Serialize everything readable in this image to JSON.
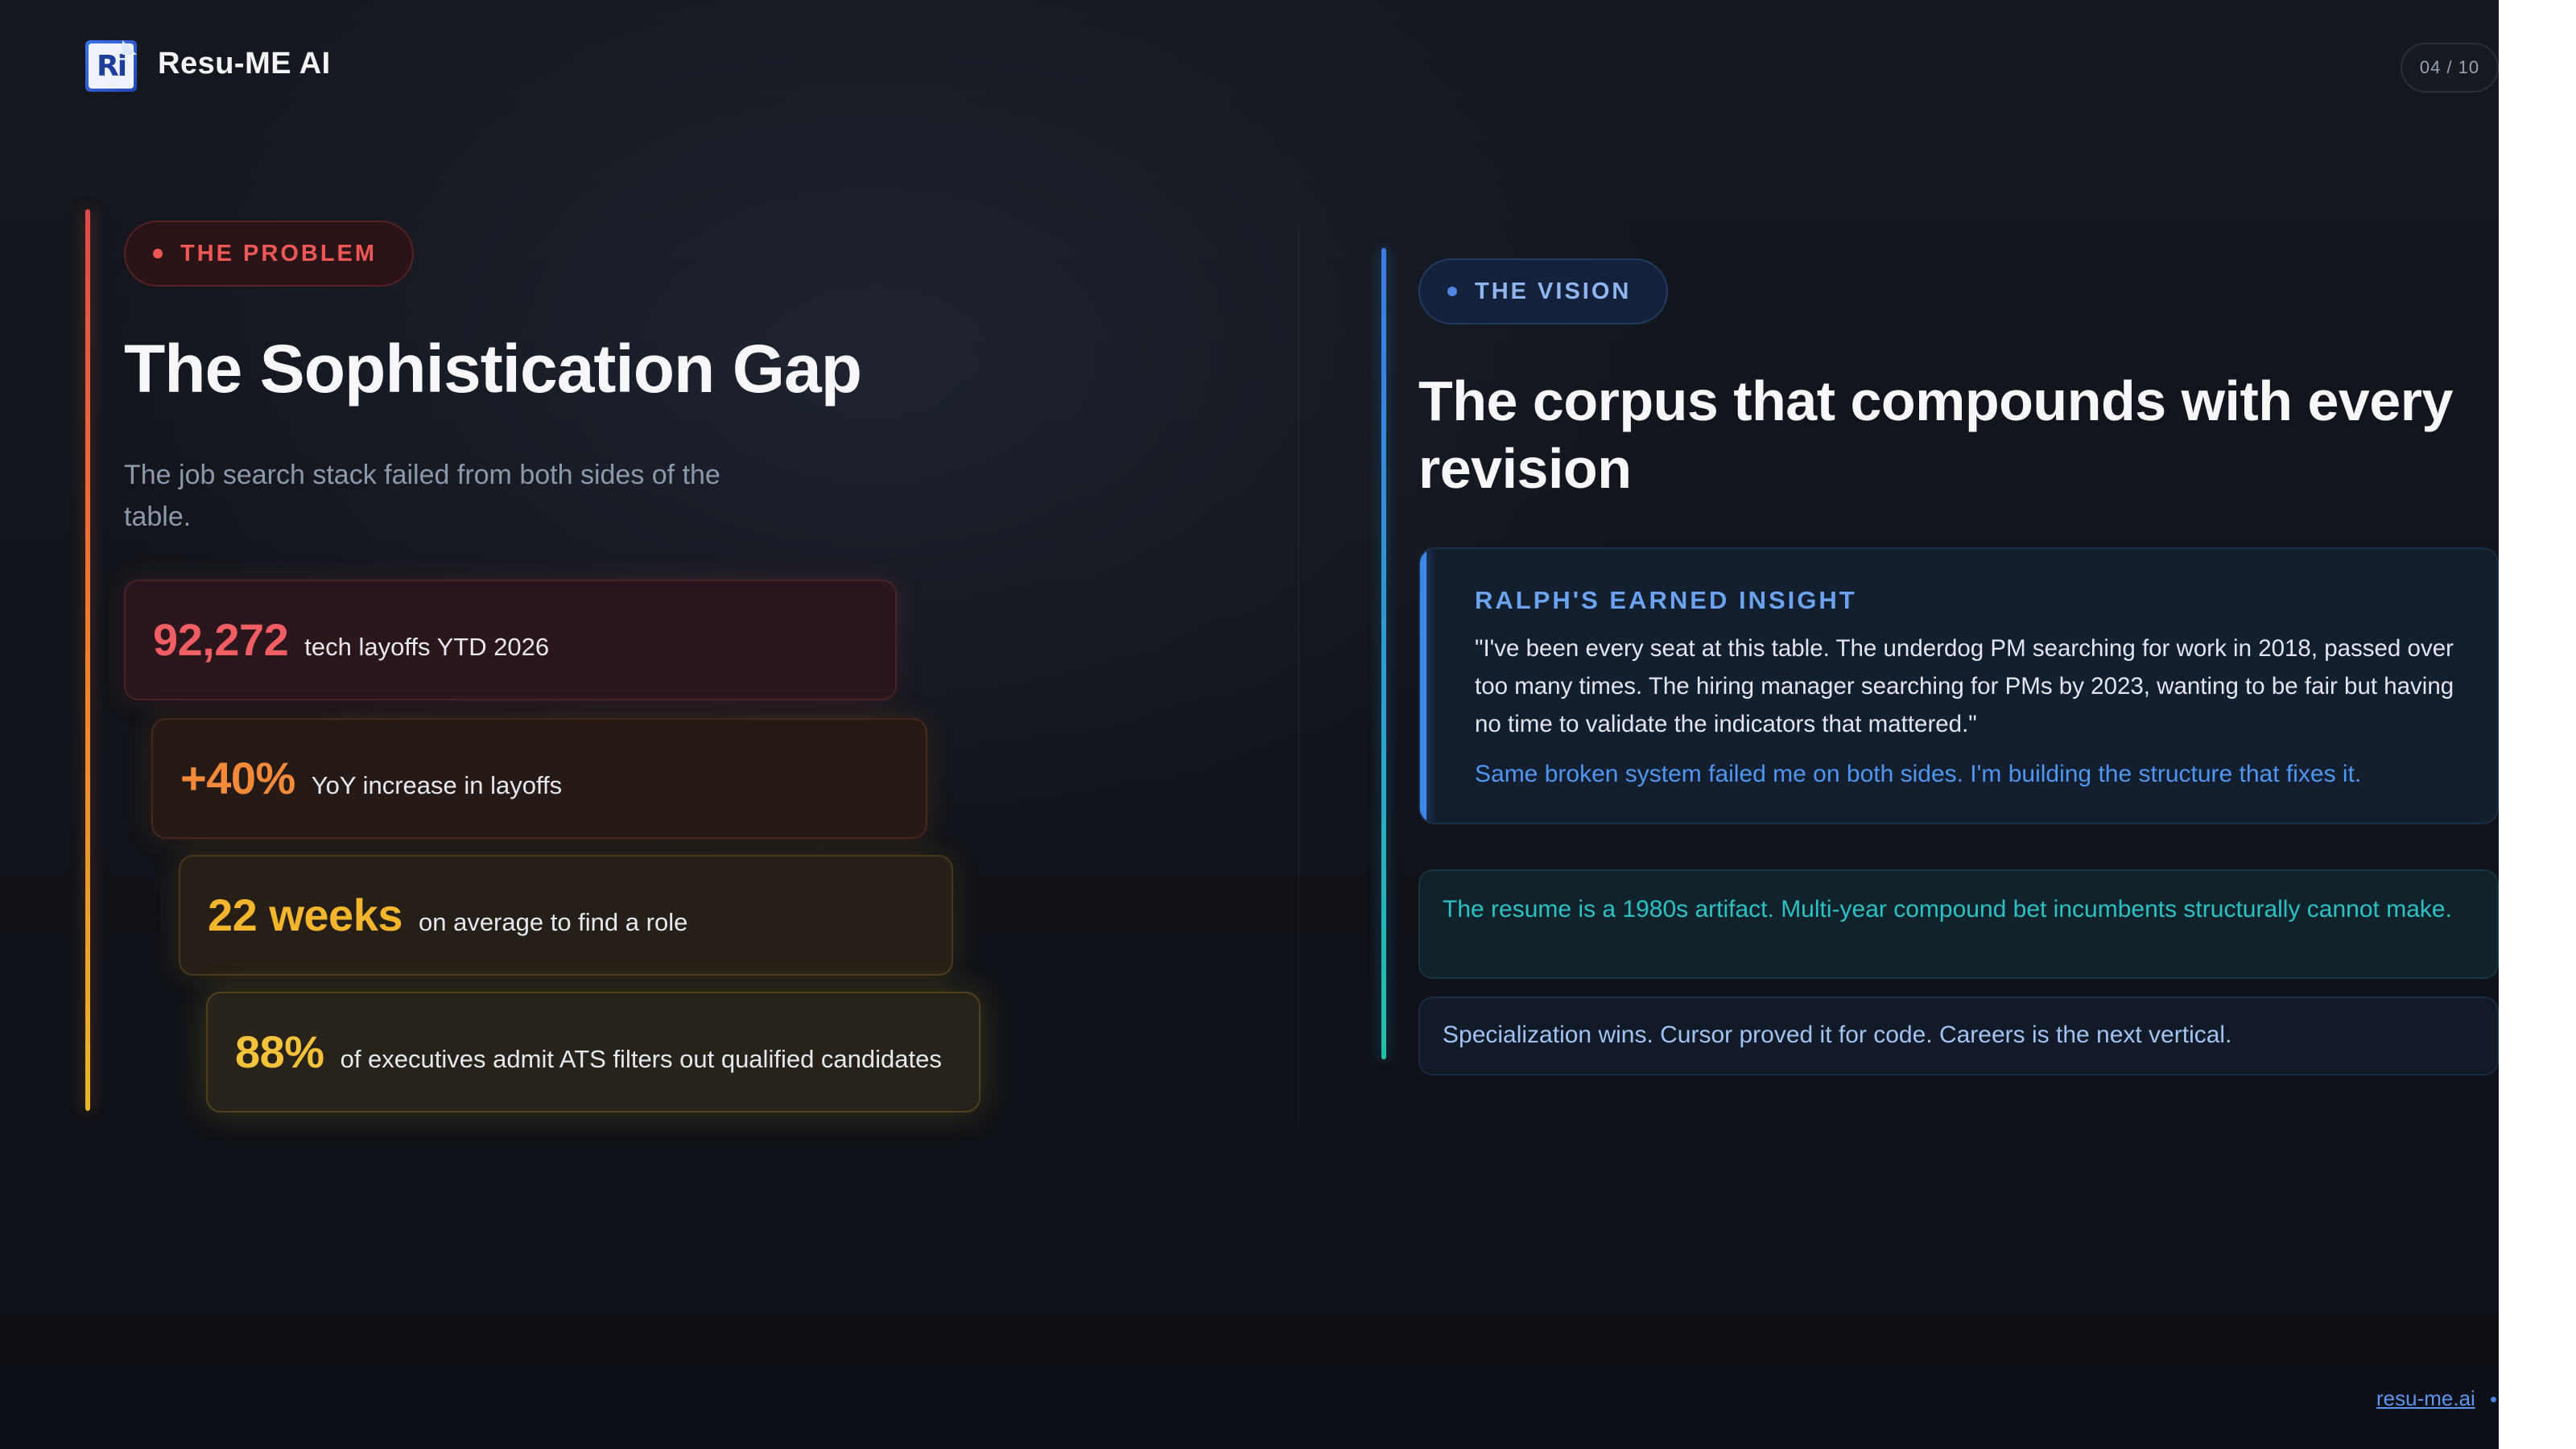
{
  "header": {
    "logo_text": "Ri",
    "brand": "Resu-ME AI",
    "page_indicator": "04 / 10"
  },
  "problem": {
    "tag": "THE PROBLEM",
    "title": "The Sophistication Gap",
    "subtitle": "The job search stack failed from both sides of the table.",
    "stats": [
      {
        "value": "92,272",
        "label": "tech layoffs YTD 2026",
        "color": "#f05d63"
      },
      {
        "value": "+40%",
        "label": "YoY increase in layoffs",
        "color": "#f28a39"
      },
      {
        "value": "22 weeks",
        "label": "on average to find a role",
        "color": "#f2b52c"
      },
      {
        "value": "88%",
        "label": "of executives admit ATS filters out qualified candidates",
        "color": "#f3c238"
      }
    ]
  },
  "vision": {
    "tag": "THE VISION",
    "title": "The corpus that compounds with every revision",
    "insight": {
      "label": "RALPH'S EARNED INSIGHT",
      "quote": "\"I've been every seat at this table. The underdog PM searching for work in 2018, passed over too many times. The hiring manager searching for PMs by 2023, wanting to be fair but having no time to validate the indicators that mattered.\"",
      "closing": "Same broken system failed me on both sides. I'm building the structure that fixes it."
    },
    "notes": [
      "The resume is a 1980s artifact. Multi-year compound bet incumbents structurally cannot make.",
      "Specialization wins. Cursor proved it for code. Careers is the next vertical."
    ]
  },
  "footer": {
    "link": "resu-me.ai"
  },
  "colors": {
    "problem_accent": "#ef5757",
    "vision_accent": "#3d86ea",
    "teal_note": "#2bc2c7",
    "background": "#121519"
  }
}
